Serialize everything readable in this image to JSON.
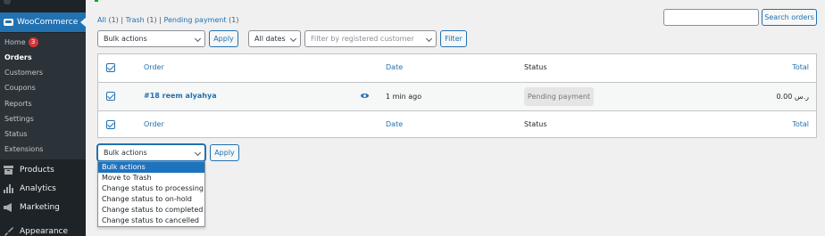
{
  "sidebar": {
    "woocommerce_label": "WooCommerce",
    "submenu": [
      {
        "label": "Home",
        "badge": "3"
      },
      {
        "label": "Orders"
      },
      {
        "label": "Customers"
      },
      {
        "label": "Coupons"
      },
      {
        "label": "Reports"
      },
      {
        "label": "Settings"
      },
      {
        "label": "Status"
      },
      {
        "label": "Extensions"
      }
    ],
    "main_items": [
      {
        "label": "Products",
        "icon": "archive-icon"
      },
      {
        "label": "Analytics",
        "icon": "bar-chart-icon"
      },
      {
        "label": "Marketing",
        "icon": "megaphone-icon"
      },
      {
        "label": "Appearance",
        "icon": "paintbrush-icon"
      }
    ]
  },
  "filters": {
    "all_label": "All",
    "all_count": "(1)",
    "trash_label": "Trash",
    "trash_count": "(1)",
    "pending_label": "Pending payment",
    "pending_count": "(1)",
    "separator": "|"
  },
  "search": {
    "value": "",
    "button_label": "Search orders"
  },
  "top_controls": {
    "bulk_actions_value": "Bulk actions",
    "apply_label": "Apply",
    "dates_value": "All dates",
    "customer_placeholder": "Filter by registered customer",
    "filter_label": "Filter"
  },
  "table": {
    "columns": {
      "order": "Order",
      "date": "Date",
      "status": "Status",
      "total": "Total"
    },
    "rows": [
      {
        "order": "#18 reem alyahya",
        "date": "1 min ago",
        "status": "Pending payment",
        "total": "0.00 ر.س"
      }
    ]
  },
  "bottom_controls": {
    "bulk_actions_value": "Bulk actions",
    "apply_label": "Apply",
    "options": [
      "Bulk actions",
      "Move to Trash",
      "Change status to processing",
      "Change status to on-hold",
      "Change status to completed",
      "Change status to cancelled"
    ],
    "selected_index": 0
  },
  "colors": {
    "accent": "#2271b1",
    "sidebar_bg": "#1d2327",
    "submenu_bg": "#2c3338",
    "badge": "#d63638",
    "option_selected": "#1e73be"
  }
}
